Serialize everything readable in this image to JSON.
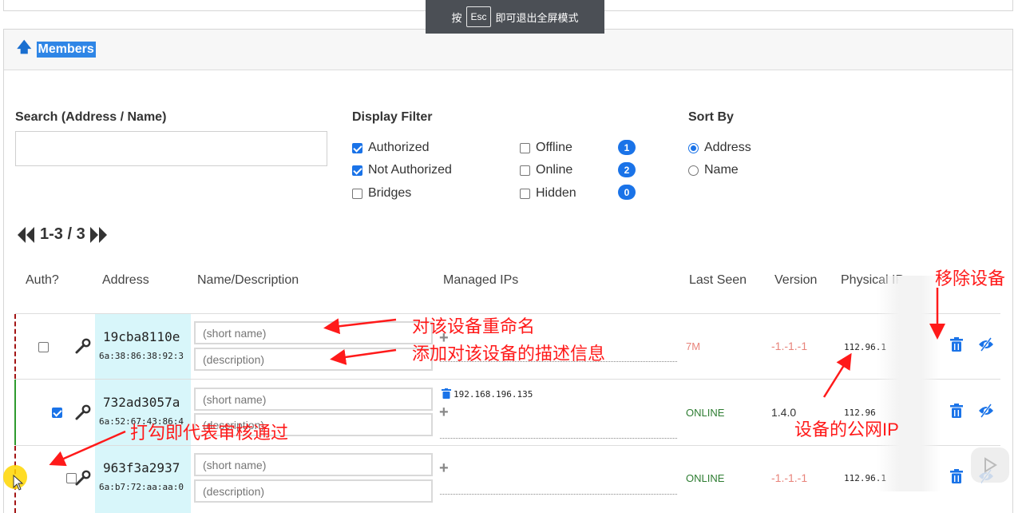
{
  "toast": {
    "prefix": "按",
    "key": "Esc",
    "suffix": "即可退出全屏模式"
  },
  "panel": {
    "title": "Members"
  },
  "search": {
    "label": "Search (Address / Name)",
    "value": ""
  },
  "display_filter": {
    "label": "Display Filter",
    "authorized": {
      "label": "Authorized",
      "checked": true
    },
    "not_authorized": {
      "label": "Not Authorized",
      "checked": true
    },
    "bridges": {
      "label": "Bridges",
      "checked": false
    },
    "offline": {
      "label": "Offline",
      "checked": false,
      "count": "1"
    },
    "online": {
      "label": "Online",
      "checked": false,
      "count": "2"
    },
    "hidden": {
      "label": "Hidden",
      "checked": false,
      "count": "0"
    }
  },
  "sort": {
    "label": "Sort By",
    "address": "Address",
    "name": "Name",
    "selected": "Address"
  },
  "pager": {
    "range": "1-3 / 3"
  },
  "columns": {
    "auth": "Auth?",
    "address": "Address",
    "name": "Name/Description",
    "ips": "Managed IPs",
    "last_seen": "Last Seen",
    "version": "Version",
    "physical": "Physical IP"
  },
  "members": [
    {
      "address": "19cba8110e",
      "mac": "6a:38:86:38:92:3",
      "authorized": false,
      "name_placeholder": "(short name)",
      "desc_placeholder": "(description)",
      "ip": "",
      "last_seen": "7M",
      "last_seen_color": "#e8837a",
      "version": "-1.-1.-1",
      "version_color": "#e8837a",
      "physical_ip": "112.96.1"
    },
    {
      "address": "732ad3057a",
      "mac": "6a:52:67:43:86:4",
      "authorized": true,
      "name_placeholder": "(short name)",
      "desc_placeholder": "(description)",
      "ip": "192.168.196.135",
      "last_seen": "ONLINE",
      "last_seen_color": "#2e7d32",
      "version": "1.4.0",
      "version_color": "#333333",
      "physical_ip": "112.96"
    },
    {
      "address": "963f3a2937",
      "mac": "6a:b7:72:aa:aa:0",
      "authorized": false,
      "name_placeholder": "(short name)",
      "desc_placeholder": "(description)",
      "ip": "",
      "last_seen": "ONLINE",
      "last_seen_color": "#2e7d32",
      "version": "-1.-1.-1",
      "version_color": "#e8837a",
      "physical_ip": "112.96.1"
    }
  ],
  "annotations": {
    "rename": "对该设备重命名",
    "describe": "添加对该设备的描述信息",
    "remove": "移除设备",
    "public_ip": "设备的公网IP",
    "authorize": "打勾即代表审核通过"
  },
  "icons": {
    "up": "arrow-up-icon",
    "first": "double-chevron-left-icon",
    "last": "double-chevron-right-icon",
    "wrench": "wrench-icon",
    "trash": "trash-icon",
    "hide": "eye-slash-icon"
  },
  "colors": {
    "accent": "#1a73e8",
    "annotation": "#ff1a1a",
    "address_bg": "#d8f6fa",
    "online": "#2e7d32"
  }
}
